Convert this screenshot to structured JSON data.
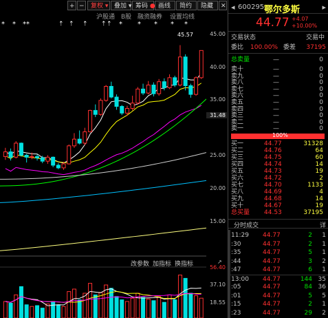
{
  "toolbar": {
    "plus_label": "+",
    "minus_label": "−",
    "rights_label": "复权",
    "overlay_label": "叠加",
    "chips_label": "筹码",
    "draw_label": "画线",
    "brief_label": "简约",
    "hide_label": "隐藏",
    "close_label": "✕"
  },
  "sub_toolbar": {
    "tabs": [
      "沪股通",
      "B股",
      "融资融券",
      "设置均线"
    ]
  },
  "price_axis": {
    "labels": [
      "45.00",
      "40.00",
      "35.00",
      "31.48",
      "25.00",
      "20.00",
      "15.00"
    ],
    "current": "31.48",
    "high_marker": "45.57"
  },
  "indicator_toolbar": {
    "params_label": "改参数",
    "add_label": "加指标",
    "switch_label": "换指标"
  },
  "volume_axis": {
    "labels": [
      "56.40",
      "37.10",
      "18.55"
    ]
  },
  "stock": {
    "code": "600295",
    "name": "鄂尔多斯",
    "price": "44.77",
    "change": "+4.07",
    "change_pct": "+10.00%",
    "status_label": "交易状态",
    "status_value": "交易中",
    "ratio_label": "委比",
    "ratio_value": "100.00%",
    "diff_label": "委差",
    "diff_value": "37195"
  },
  "order_book": {
    "sell_total_label": "总卖量",
    "sell_total_value": "0",
    "sells": [
      {
        "label": "卖十",
        "price": "—",
        "vol": "0"
      },
      {
        "label": "卖九",
        "price": "—",
        "vol": "0"
      },
      {
        "label": "卖八",
        "price": "—",
        "vol": "0"
      },
      {
        "label": "卖七",
        "price": "—",
        "vol": "0"
      },
      {
        "label": "卖六",
        "price": "—",
        "vol": "0"
      },
      {
        "label": "卖五",
        "price": "—",
        "vol": "0"
      },
      {
        "label": "卖四",
        "price": "—",
        "vol": "0"
      },
      {
        "label": "卖三",
        "price": "—",
        "vol": "0"
      },
      {
        "label": "卖二",
        "price": "—",
        "vol": "0"
      },
      {
        "label": "卖一",
        "price": "—",
        "vol": "0"
      }
    ],
    "ratio_bar_label": "100%",
    "buys": [
      {
        "label": "买一",
        "price": "44.77",
        "vol": "31328"
      },
      {
        "label": "买二",
        "price": "44.76",
        "vol": "64"
      },
      {
        "label": "买三",
        "price": "44.75",
        "vol": "60"
      },
      {
        "label": "买四",
        "price": "44.74",
        "vol": "14"
      },
      {
        "label": "买五",
        "price": "44.73",
        "vol": "19"
      },
      {
        "label": "买六",
        "price": "44.72",
        "vol": "2"
      },
      {
        "label": "买七",
        "price": "44.70",
        "vol": "1133"
      },
      {
        "label": "买八",
        "price": "44.69",
        "vol": "4"
      },
      {
        "label": "买九",
        "price": "44.68",
        "vol": "14"
      },
      {
        "label": "买十",
        "price": "44.67",
        "vol": "19"
      }
    ],
    "buy_total_label": "总买量",
    "buy_total_price": "44.53",
    "buy_total_value": "37195"
  },
  "ticks": {
    "title": "分时成交",
    "detail_label": "详",
    "rows": [
      {
        "time": "11:29",
        "price": "44.77",
        "vol": "2",
        "cnt": "1",
        "vol_color": "#00e000"
      },
      {
        "time": ":30",
        "price": "44.77",
        "vol": "2",
        "cnt": "1",
        "vol_color": "#00e000"
      },
      {
        "time": ":35",
        "price": "44.77",
        "vol": "5",
        "cnt": "1",
        "vol_color": "#00e000"
      },
      {
        "time": ":44",
        "price": "44.77",
        "vol": "3",
        "cnt": "2",
        "vol_color": "#00e000"
      },
      {
        "time": ":47",
        "price": "44.77",
        "vol": "6",
        "cnt": "1",
        "vol_color": "#00e000"
      },
      {
        "time": "13:00",
        "price": "44.77",
        "vol": "144",
        "cnt": "35",
        "vol_color": "#00e000"
      },
      {
        "time": ":05",
        "price": "44.77",
        "vol": "84",
        "cnt": "36",
        "vol_color": "#00e000"
      },
      {
        "time": ":01",
        "price": "44.77",
        "vol": "5",
        "cnt": "5",
        "vol_color": "#00e000"
      },
      {
        "time": ":15",
        "price": "44.77",
        "vol": "2",
        "cnt": "1",
        "vol_color": "#00e000"
      },
      {
        "time": ":23",
        "price": "44.77",
        "vol": "29",
        "cnt": "2",
        "vol_color": "#00e000"
      }
    ]
  },
  "colors": {
    "up": "#ff3030",
    "down": "#00e0e0",
    "ma5": "#ffffff",
    "ma10": "#ffff00",
    "ma20": "#ff00ff",
    "ma30": "#00ff00",
    "ma60": "#d0d0d0",
    "ma120": "#00c0ff",
    "ma250": "#ffff80"
  },
  "chart_data": {
    "type": "candlestick",
    "ylim": [
      14,
      48
    ],
    "vol_ylim": [
      0,
      60
    ],
    "candles": [
      {
        "o": 28.9,
        "c": 29.6,
        "h": 30.2,
        "l": 28.4,
        "v": 20
      },
      {
        "o": 29.6,
        "c": 28.8,
        "h": 30.1,
        "l": 28.3,
        "v": 18
      },
      {
        "o": 28.8,
        "c": 30.9,
        "h": 31.2,
        "l": 28.6,
        "v": 28
      },
      {
        "o": 30.9,
        "c": 29.1,
        "h": 31.0,
        "l": 28.9,
        "v": 38
      },
      {
        "o": 29.1,
        "c": 28.8,
        "h": 29.3,
        "l": 28.0,
        "v": 16
      },
      {
        "o": 28.8,
        "c": 28.9,
        "h": 29.5,
        "l": 28.5,
        "v": 14
      },
      {
        "o": 28.9,
        "c": 28.7,
        "h": 29.2,
        "l": 28.3,
        "v": 15
      },
      {
        "o": 28.7,
        "c": 28.2,
        "h": 29.0,
        "l": 27.9,
        "v": 12
      },
      {
        "o": 28.2,
        "c": 28.8,
        "h": 29.1,
        "l": 27.8,
        "v": 17
      },
      {
        "o": 28.8,
        "c": 27.6,
        "h": 28.9,
        "l": 27.3,
        "v": 20
      },
      {
        "o": 27.6,
        "c": 27.2,
        "h": 27.9,
        "l": 27.0,
        "v": 16
      },
      {
        "o": 27.2,
        "c": 27.8,
        "h": 28.1,
        "l": 26.9,
        "v": 14
      },
      {
        "o": 27.8,
        "c": 30.5,
        "h": 30.7,
        "l": 27.7,
        "v": 32
      },
      {
        "o": 30.5,
        "c": 31.5,
        "h": 32.4,
        "l": 30.2,
        "v": 35
      },
      {
        "o": 31.5,
        "c": 30.9,
        "h": 32.8,
        "l": 30.7,
        "v": 22
      },
      {
        "o": 30.9,
        "c": 32.6,
        "h": 33.2,
        "l": 30.6,
        "v": 30
      },
      {
        "o": 32.6,
        "c": 35.8,
        "h": 35.9,
        "l": 32.5,
        "v": 42
      },
      {
        "o": 35.8,
        "c": 35.2,
        "h": 36.7,
        "l": 34.8,
        "v": 28
      },
      {
        "o": 35.2,
        "c": 37.3,
        "h": 37.6,
        "l": 35.0,
        "v": 31
      },
      {
        "o": 37.3,
        "c": 39.4,
        "h": 39.6,
        "l": 37.1,
        "v": 40
      },
      {
        "o": 39.4,
        "c": 37.8,
        "h": 40.1,
        "l": 37.6,
        "v": 36
      },
      {
        "o": 37.8,
        "c": 36.4,
        "h": 38.2,
        "l": 35.9,
        "v": 26
      },
      {
        "o": 36.4,
        "c": 35.4,
        "h": 36.6,
        "l": 35.1,
        "v": 22
      },
      {
        "o": 35.4,
        "c": 36.1,
        "h": 36.5,
        "l": 35.0,
        "v": 20
      },
      {
        "o": 36.1,
        "c": 36.9,
        "h": 38.0,
        "l": 35.8,
        "v": 24
      },
      {
        "o": 36.9,
        "c": 39.0,
        "h": 39.3,
        "l": 36.7,
        "v": 30
      },
      {
        "o": 39.0,
        "c": 38.4,
        "h": 39.8,
        "l": 38.1,
        "v": 25
      },
      {
        "o": 38.4,
        "c": 39.6,
        "h": 40.2,
        "l": 38.2,
        "v": 23
      },
      {
        "o": 39.6,
        "c": 38.3,
        "h": 40.0,
        "l": 37.9,
        "v": 21
      },
      {
        "o": 38.3,
        "c": 40.1,
        "h": 40.5,
        "l": 38.0,
        "v": 26
      },
      {
        "o": 40.1,
        "c": 39.2,
        "h": 40.6,
        "l": 38.8,
        "v": 19
      },
      {
        "o": 39.2,
        "c": 40.7,
        "h": 41.2,
        "l": 39.0,
        "v": 28
      },
      {
        "o": 40.7,
        "c": 39.6,
        "h": 41.0,
        "l": 39.3,
        "v": 22
      },
      {
        "o": 39.6,
        "c": 43.8,
        "h": 45.57,
        "l": 39.4,
        "v": 52
      },
      {
        "o": 43.8,
        "c": 39.5,
        "h": 44.2,
        "l": 38.8,
        "v": 48
      },
      {
        "o": 39.5,
        "c": 38.2,
        "h": 39.8,
        "l": 37.7,
        "v": 30
      },
      {
        "o": 38.2,
        "c": 40.7,
        "h": 40.9,
        "l": 38.0,
        "v": 27
      },
      {
        "o": 40.7,
        "c": 44.77,
        "h": 44.77,
        "l": 40.5,
        "v": 24
      }
    ]
  }
}
